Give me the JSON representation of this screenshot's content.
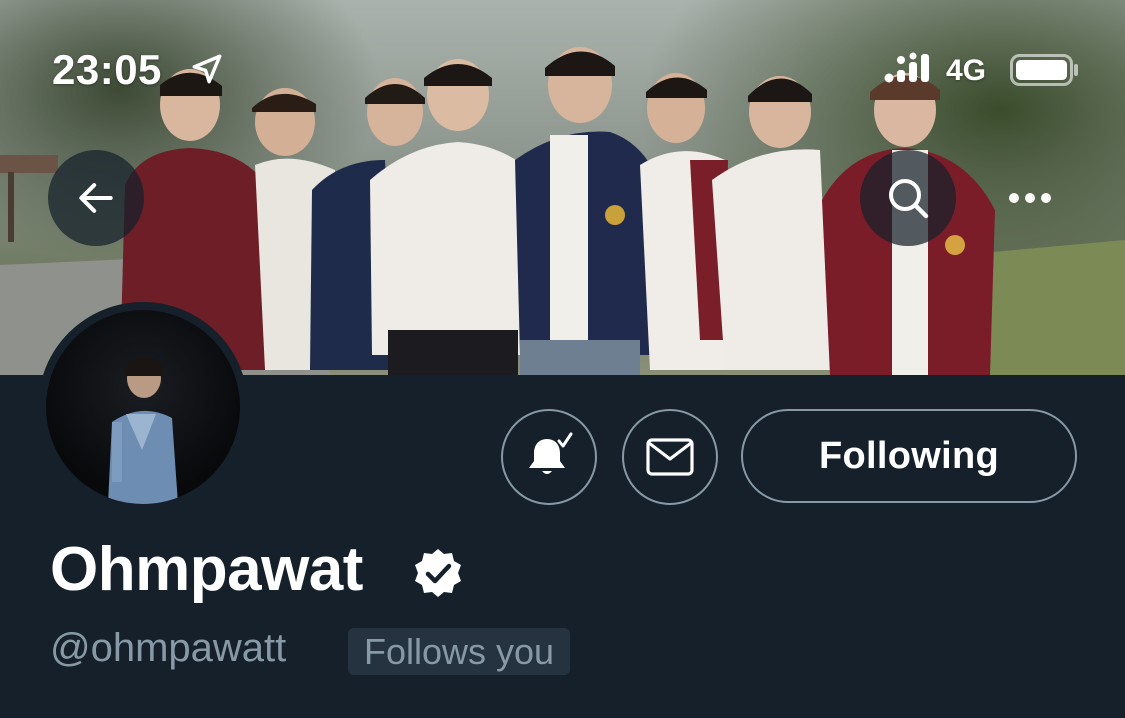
{
  "status_bar": {
    "time": "23:05",
    "network": "4G",
    "location_icon": "location-arrow-icon",
    "signal_icon": "signal-dots-icon",
    "battery_icon": "battery-icon"
  },
  "nav": {
    "back_icon": "back-arrow-icon",
    "search_icon": "search-icon",
    "more_icon": "more-dots-icon"
  },
  "profile": {
    "display_name": "Ohmpawat",
    "handle": "@ohmpawatt",
    "follows_you_label": "Follows you",
    "verified_icon": "verified-badge-icon"
  },
  "actions": {
    "notify_icon": "bell-check-icon",
    "message_icon": "envelope-icon",
    "following_label": "Following"
  },
  "colors": {
    "background": "#15202b",
    "secondary_text": "#8899a6",
    "badge_bg": "#253341",
    "primary_text": "#ffffff"
  }
}
